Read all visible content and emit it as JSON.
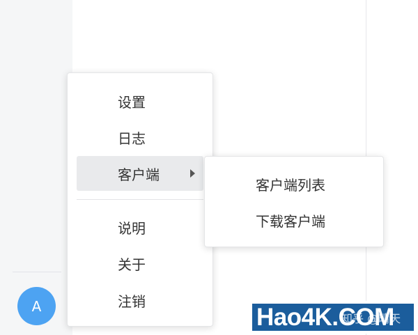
{
  "sidebar": {
    "avatar_letter": "A"
  },
  "context_menu": {
    "items": [
      {
        "label": "设置"
      },
      {
        "label": "日志"
      },
      {
        "label": "客户端"
      },
      {
        "label": "说明"
      },
      {
        "label": "关于"
      },
      {
        "label": "注销"
      }
    ]
  },
  "submenu": {
    "items": [
      {
        "label": "客户端列表"
      },
      {
        "label": "下载客户端"
      }
    ]
  },
  "watermark": {
    "logo_text": "Hao4K.COM",
    "credit_text": "知乎 @晴天"
  },
  "colors": {
    "avatar": "#4da3f2",
    "active_item_bg": "#e9eaec",
    "watermark_bg": "#1b5d9c"
  }
}
